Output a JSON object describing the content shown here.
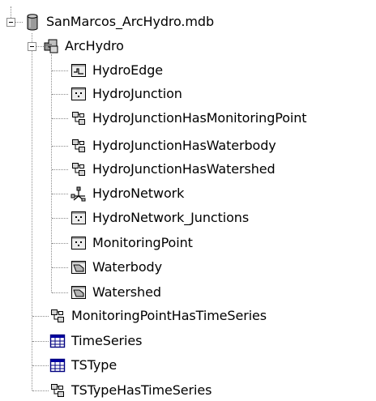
{
  "tree": {
    "root": {
      "label": "SanMarcos_ArcHydro.mdb",
      "icon": "database-icon",
      "expanded": true
    },
    "dataset": {
      "label": "ArcHydro",
      "icon": "feature-dataset-icon",
      "expanded": true
    },
    "dataset_children": [
      {
        "label": "HydroEdge",
        "icon": "line-feature-class-icon"
      },
      {
        "label": "HydroJunction",
        "icon": "point-feature-class-icon"
      },
      {
        "label": "HydroJunctionHasMonitoringPoint",
        "icon": "relationship-class-icon"
      },
      {
        "label": "HydroJunctionHasWaterbody",
        "icon": "relationship-class-icon"
      },
      {
        "label": "HydroJunctionHasWatershed",
        "icon": "relationship-class-icon"
      },
      {
        "label": "HydroNetwork",
        "icon": "geometric-network-icon"
      },
      {
        "label": "HydroNetwork_Junctions",
        "icon": "point-feature-class-icon"
      },
      {
        "label": "MonitoringPoint",
        "icon": "point-feature-class-icon"
      },
      {
        "label": "Waterbody",
        "icon": "polygon-feature-class-icon"
      },
      {
        "label": "Watershed",
        "icon": "polygon-feature-class-icon"
      }
    ],
    "root_children": [
      {
        "label": "MonitoringPointHasTimeSeries",
        "icon": "relationship-class-icon"
      },
      {
        "label": "TimeSeries",
        "icon": "table-icon"
      },
      {
        "label": "TSType",
        "icon": "table-icon"
      },
      {
        "label": "TSTypeHasTimeSeries",
        "icon": "relationship-class-icon"
      }
    ]
  }
}
